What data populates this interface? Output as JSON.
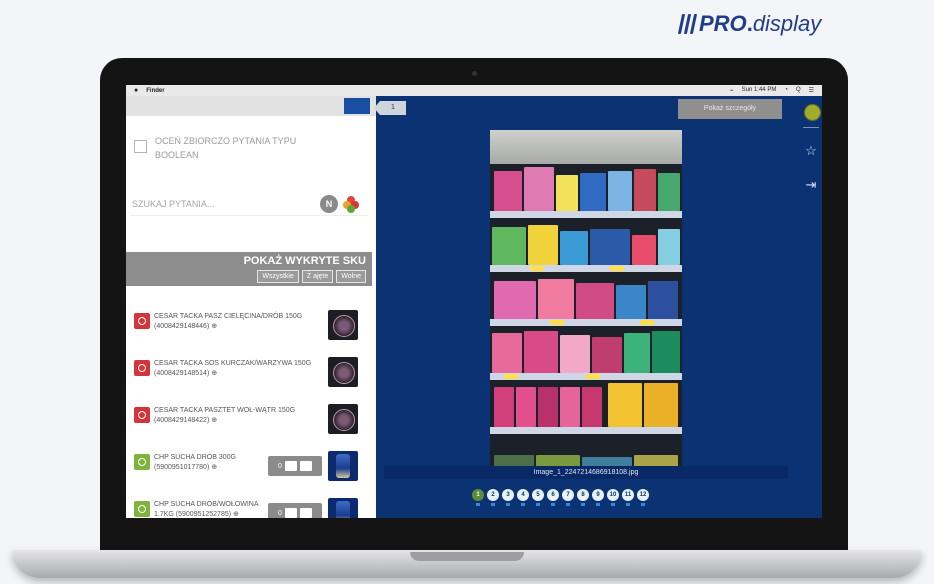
{
  "brand": {
    "pro": "PRO",
    "dot": ".",
    "display": "display"
  },
  "menubar": {
    "apple": "●",
    "app_name": "Finder",
    "status": [
      "⌁",
      "Sun 1:44 PM",
      "◔",
      "Q",
      "☰"
    ]
  },
  "left_panel": {
    "boolean_label": "OCEŃ ZBIORCZO PYTANIA TYPU BOOLEAN",
    "search_placeholder": "SZUKAJ PYTANIA...",
    "round_button": "N",
    "sku_title": "POKAŻ WYKRYTE SKU",
    "filters": [
      "Wszystkie",
      "Ż ajęte",
      "Wolne"
    ],
    "skus": [
      {
        "name": "CESAR TACKA PASZ CIELĘCINA/DRÓB 150G (4008429148446) ⊕",
        "status": "red",
        "thumb": "tray"
      },
      {
        "name": "CESAR TACKA SOS KURCZAK/WARZYWA 150G (4008429148514) ⊕",
        "status": "red",
        "thumb": "tray"
      },
      {
        "name": "CESAR TACKA PASZTET WOŁ-WĄTR 150G (4008429148422) ⊕",
        "status": "red",
        "thumb": "tray"
      },
      {
        "name": "CHP SUCHA DRÓB 300G (5900951017780) ⊕",
        "status": "green",
        "thumb": "bag",
        "qty_label": "0"
      },
      {
        "name": "CHP SUCHA DRÓB/WOŁOWINA 1.7KG (5900951252785) ⊕",
        "status": "green",
        "thumb": "bag",
        "qty_label": "0"
      }
    ]
  },
  "viewer": {
    "counter": "1",
    "top_button": "Pokaż szczegóły",
    "filename": "Image_1_2247214686918108.jpg",
    "pages": [
      "1",
      "2",
      "3",
      "4",
      "5",
      "6",
      "7",
      "8",
      "9",
      "10",
      "11",
      "12"
    ]
  },
  "colors": {
    "screen_bg": "#0b3374",
    "brand": "#1f3d8a",
    "status_red": "#d5343a",
    "status_green": "#7fb33e"
  }
}
